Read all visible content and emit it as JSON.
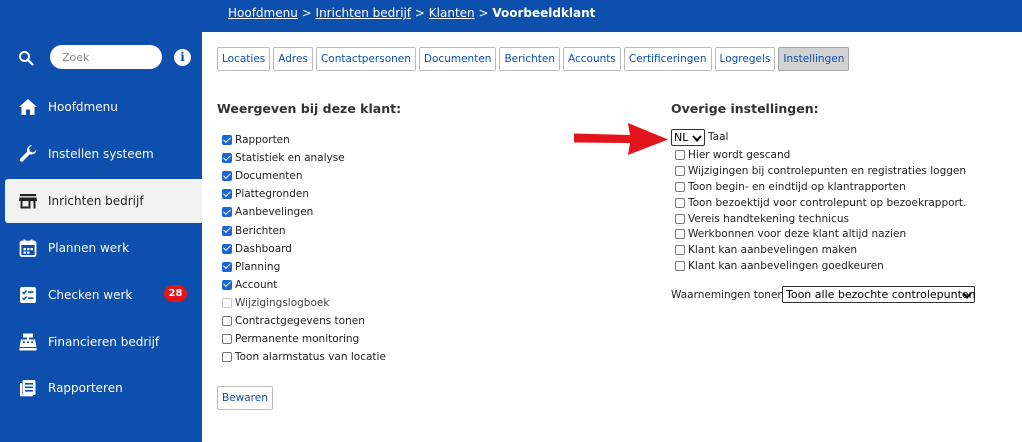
{
  "sidebar": {
    "search_placeholder": "Zoek",
    "info_symbol": "i",
    "items": [
      {
        "label": "Hoofdmenu",
        "icon": "home-icon"
      },
      {
        "label": "Instellen systeem",
        "icon": "wrench-icon"
      },
      {
        "label": "Inrichten bedrijf",
        "icon": "store-icon",
        "active": true
      },
      {
        "label": "Plannen werk",
        "icon": "calendar-icon"
      },
      {
        "label": "Checken werk",
        "icon": "checklist-icon",
        "badge": "28"
      },
      {
        "label": "Financieren bedrijf",
        "icon": "cash-register-icon"
      },
      {
        "label": "Rapporteren",
        "icon": "report-icon"
      }
    ]
  },
  "breadcrumb": {
    "item1": "Hoofdmenu",
    "sep": " > ",
    "item2": "Inrichten bedrijf",
    "item3": "Klanten",
    "current": "Voorbeeldklant"
  },
  "tabs": [
    "Locaties",
    "Adres",
    "Contactpersonen",
    "Documenten",
    "Berichten",
    "Accounts",
    "Certificeringen",
    "Logregels",
    "Instellingen"
  ],
  "active_tab": "Instellingen",
  "left_panel": {
    "title": "Weergeven bij deze klant:",
    "items": [
      {
        "label": "Rapporten",
        "checked": true
      },
      {
        "label": "Statistiek en analyse",
        "checked": true
      },
      {
        "label": "Documenten",
        "checked": true
      },
      {
        "label": "Plattegronden",
        "checked": true
      },
      {
        "label": "Aanbevelingen",
        "checked": true
      },
      {
        "label": "Berichten",
        "checked": true
      },
      {
        "label": "Dashboard",
        "checked": true
      },
      {
        "label": "Planning",
        "checked": true
      },
      {
        "label": "Account",
        "checked": true
      },
      {
        "label": "Wijzigingslogboek",
        "checked": false,
        "disabled": true
      },
      {
        "label": "Contractgegevens tonen",
        "checked": false
      },
      {
        "label": "Permanente monitoring",
        "checked": false
      },
      {
        "label": "Toon alarmstatus van locatie",
        "checked": false
      }
    ],
    "save_label": "Bewaren"
  },
  "right_panel": {
    "title": "Overige instellingen:",
    "language_value": "NL",
    "language_label": "Taal",
    "items": [
      {
        "label": "Hier wordt gescand",
        "checked": false
      },
      {
        "label": "Wijzigingen bij controlepunten en registraties loggen",
        "checked": false
      },
      {
        "label": "Toon begin- en eindtijd op klantrapporten",
        "checked": false
      },
      {
        "label": "Toon bezoektijd voor controlepunt op bezoekrapport.",
        "checked": false
      },
      {
        "label": "Vereis handtekening technicus",
        "checked": false
      },
      {
        "label": "Werkbonnen voor deze klant altijd nazien",
        "checked": false
      },
      {
        "label": "Klant kan aanbevelingen maken",
        "checked": false
      },
      {
        "label": "Klant kan aanbevelingen goedkeuren",
        "checked": false
      }
    ],
    "observations_label": "Waarnemingen tonen:",
    "observations_value": "Toon alle bezochte controlepunten"
  },
  "colors": {
    "brand_blue": "#0d4fad",
    "checkbox_blue": "#1a66d6",
    "badge_red": "#e0161b",
    "arrow_red": "#e3141b"
  }
}
